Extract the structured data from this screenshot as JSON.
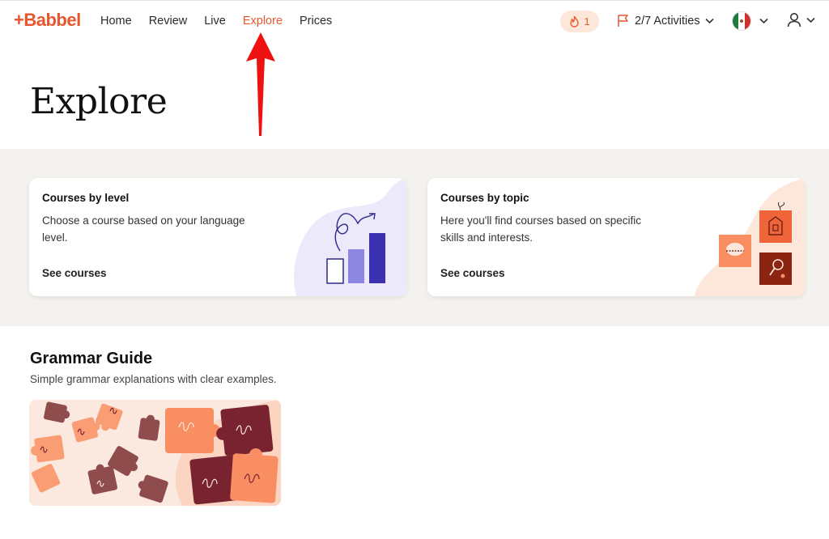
{
  "brand": {
    "logo_text": "+Babbel",
    "accent": "#e8562d"
  },
  "nav": {
    "items": [
      {
        "label": "Home",
        "active": false
      },
      {
        "label": "Review",
        "active": false
      },
      {
        "label": "Live",
        "active": false
      },
      {
        "label": "Explore",
        "active": true
      },
      {
        "label": "Prices",
        "active": false
      }
    ]
  },
  "header": {
    "streak_count": "1",
    "activities_label": "2/7 Activities",
    "language_flag": "mexico-flag-icon",
    "user_icon": "user-icon"
  },
  "page": {
    "title": "Explore"
  },
  "cards": [
    {
      "title": "Courses by level",
      "description": "Choose a course based on your language level.",
      "link": "See courses"
    },
    {
      "title": "Courses by topic",
      "description": "Here you'll find courses based on specific skills and interests.",
      "link": "See courses"
    }
  ],
  "grammar": {
    "title": "Grammar Guide",
    "subtitle": "Simple grammar explanations with clear examples."
  }
}
